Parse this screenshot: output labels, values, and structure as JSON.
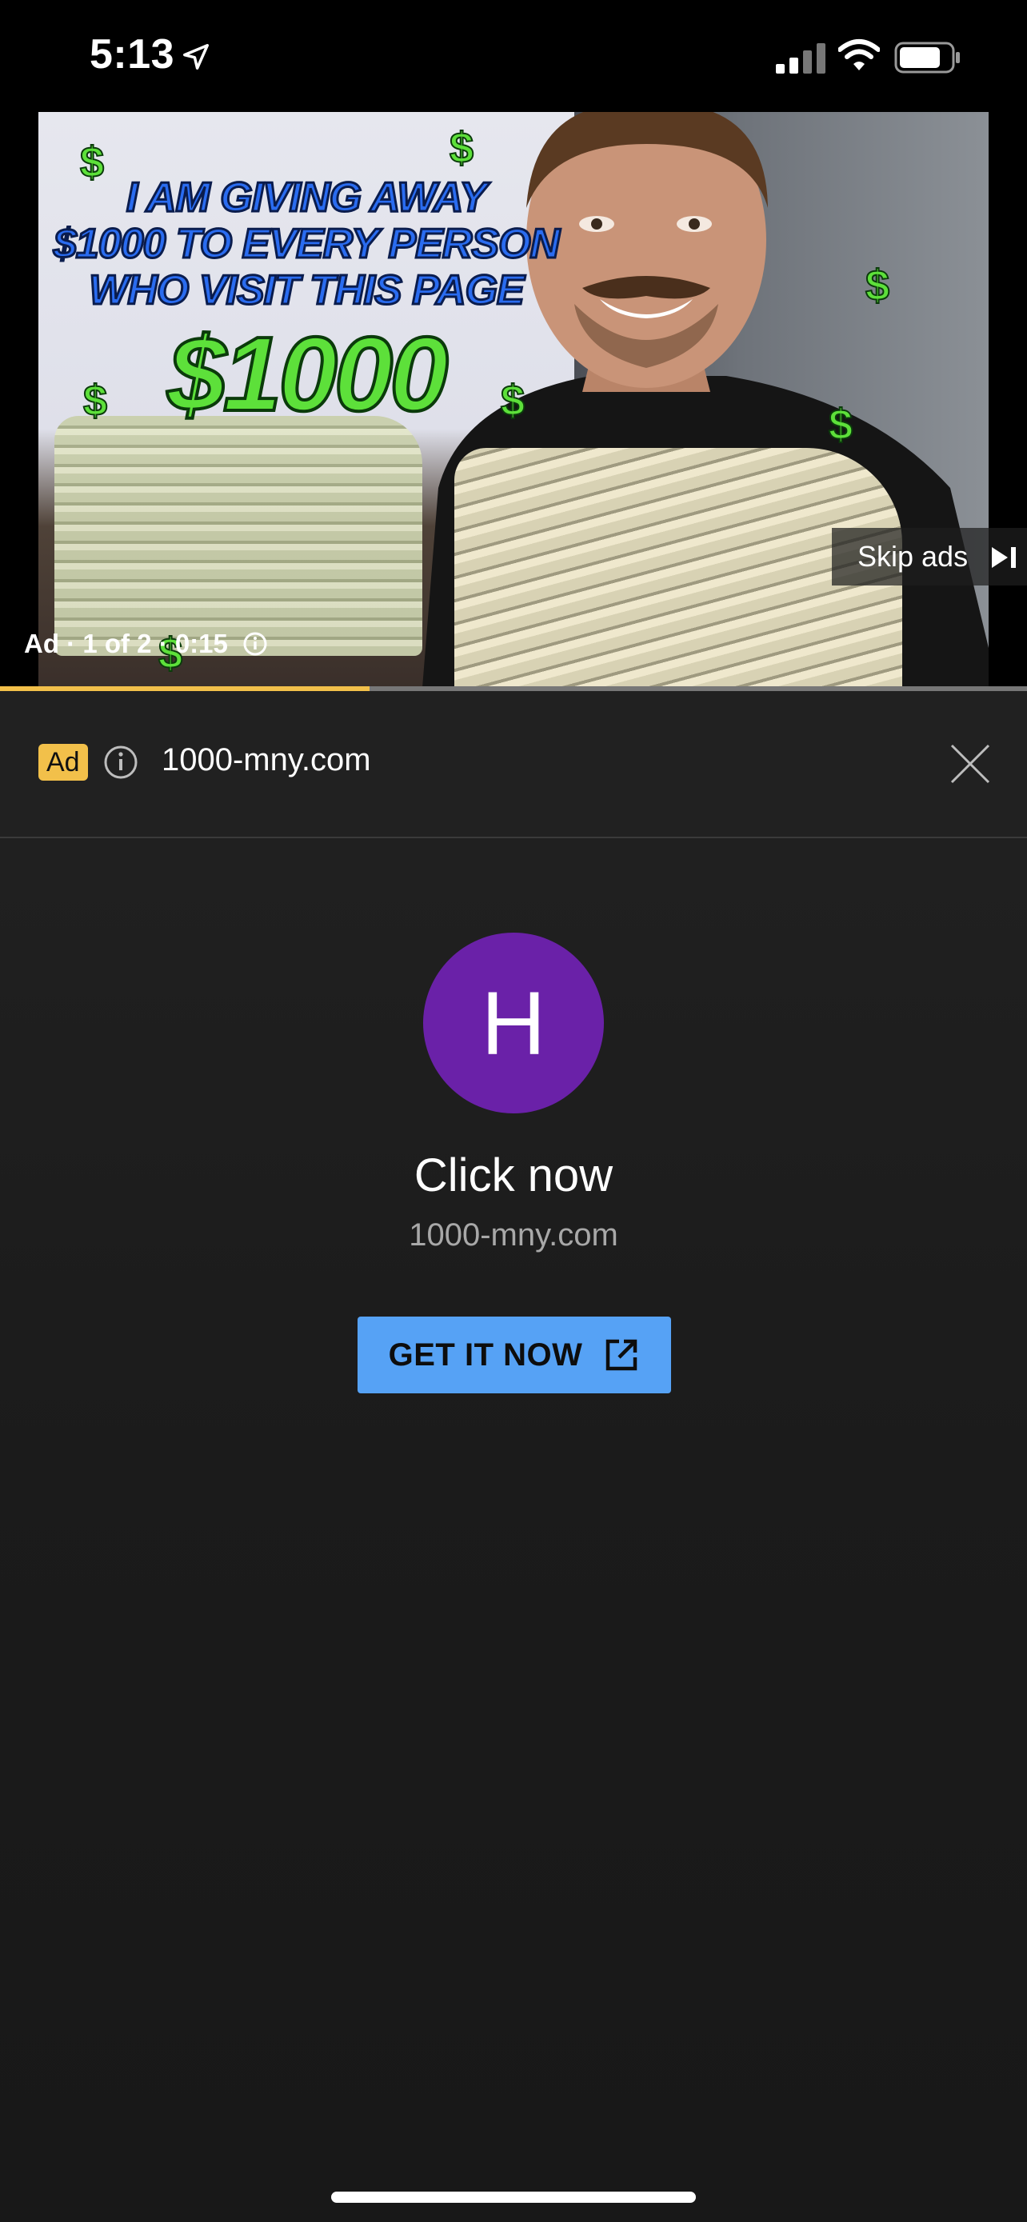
{
  "status_bar": {
    "time": "5:13",
    "icons": [
      "location-arrow-icon",
      "cellular-signal-icon",
      "wifi-icon",
      "battery-icon"
    ]
  },
  "player": {
    "thumbnail": {
      "headline_lines": [
        "I AM GIVING AWAY",
        "$1000 TO EVERY PERSON",
        "WHO VISIT THIS PAGE"
      ],
      "amount": "$1000",
      "dollar_symbol": "$"
    },
    "skip_label": "Skip ads",
    "ad_meta": "Ad · 1 of 2 · 0:15",
    "progress_fraction": 0.36,
    "progress_color": "#f2c04a"
  },
  "ad_header": {
    "badge": "Ad",
    "domain": "1000-mny.com"
  },
  "ad_body": {
    "avatar_letter": "H",
    "avatar_color": "#6a21a8",
    "headline": "Click now",
    "domain": "1000-mny.com",
    "cta_label": "GET IT NOW",
    "cta_color": "#56a2f5"
  }
}
